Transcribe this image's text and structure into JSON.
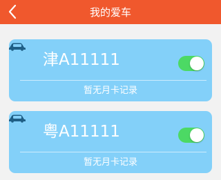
{
  "header": {
    "title": "我的爱车",
    "back_icon": "chevron-left-icon",
    "background": "#f0582d"
  },
  "cars": [
    {
      "plate": "津A11111",
      "record_status": "暂无月卡记录",
      "toggle_on": true,
      "icon": "car-icon"
    },
    {
      "plate": "粤A11111",
      "record_status": "暂无月卡记录",
      "toggle_on": true,
      "icon": "car-icon"
    }
  ],
  "colors": {
    "card": "#83d0f9",
    "toggle_on": "#4cd964",
    "page_bg": "#f2f2f2"
  }
}
